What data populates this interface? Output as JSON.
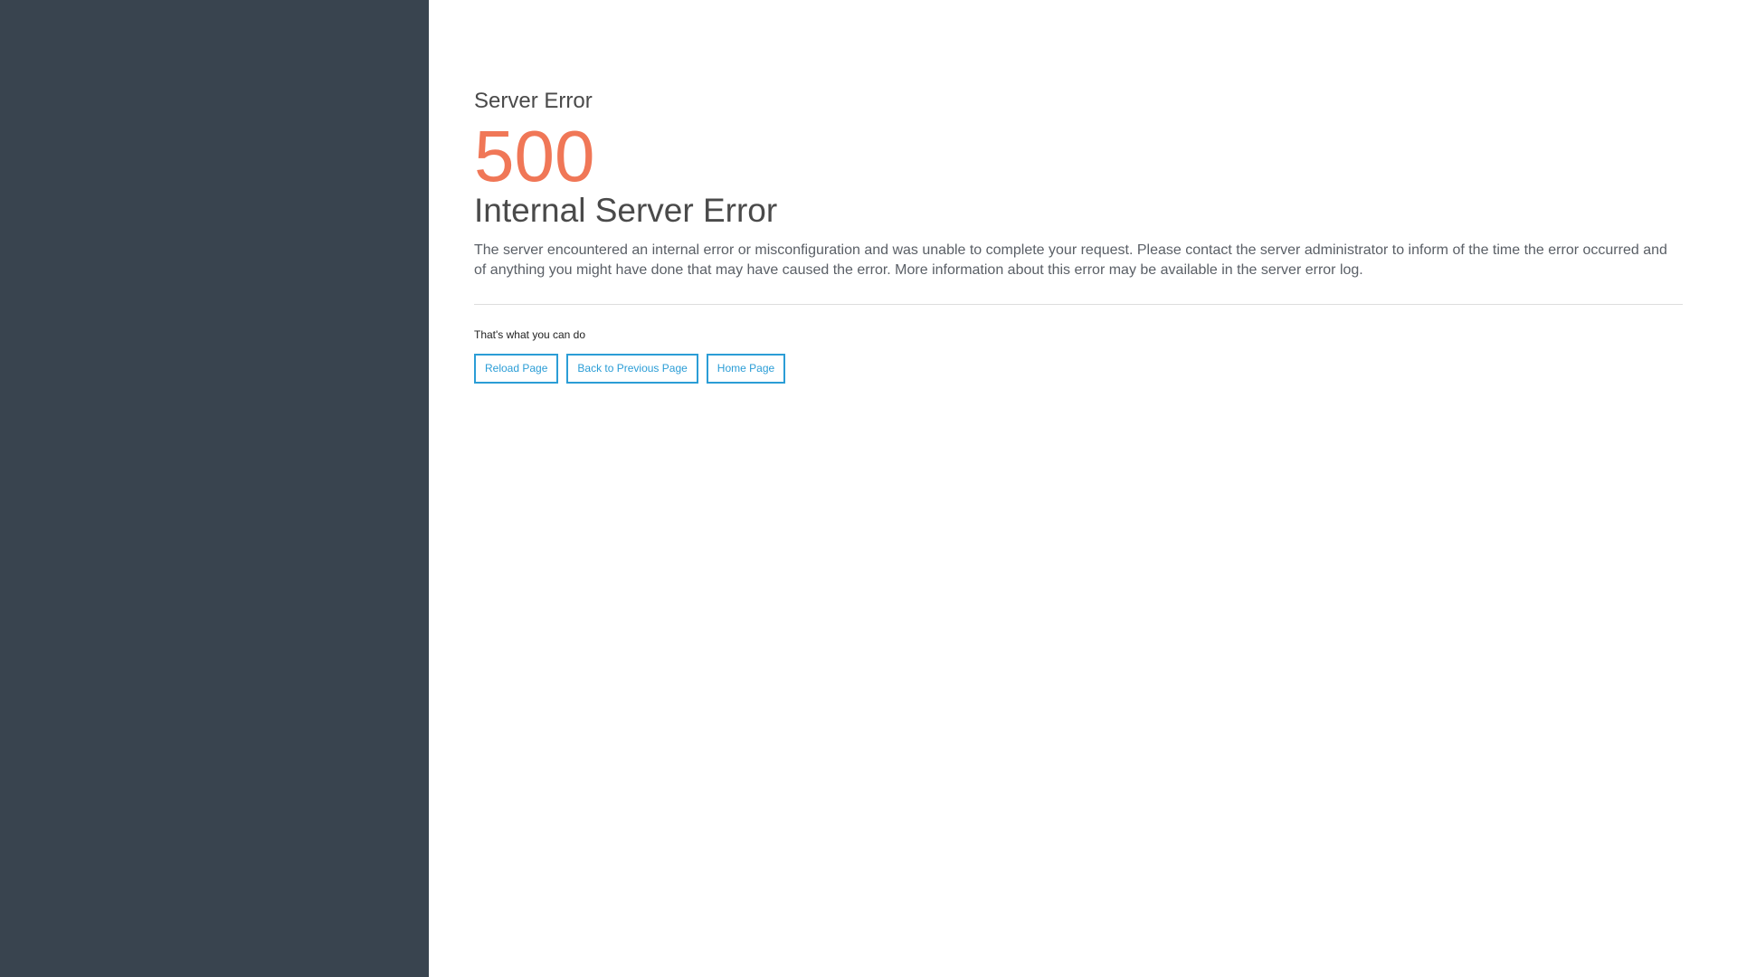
{
  "error": {
    "eyebrow": "Server Error",
    "code": "500",
    "title": "Internal Server Error",
    "description": "The server encountered an internal error or misconfiguration and was unable to complete your request. Please contact the server administrator to inform of the time the error occurred and of anything you might have done that may have caused the error. More information about this error may be available in the server error log."
  },
  "actions": {
    "label": "That's what you can do",
    "reload": "Reload Page",
    "back": "Back to Previous Page",
    "home": "Home Page"
  },
  "colors": {
    "sidebar": "#39444f",
    "accent_code": "#f07757",
    "button_accent": "#2b9dd6"
  }
}
